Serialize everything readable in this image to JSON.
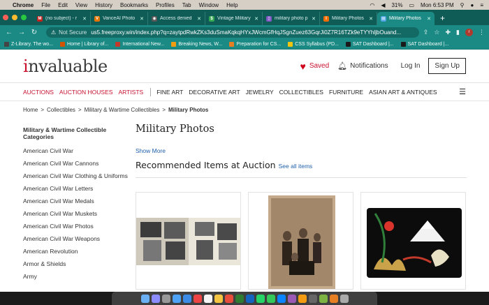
{
  "menubar": {
    "app": "Chrome",
    "items": [
      "File",
      "Edit",
      "View",
      "History",
      "Bookmarks",
      "Profiles",
      "Tab",
      "Window",
      "Help"
    ],
    "battery": "31%",
    "clock": "Mon 6:53 PM"
  },
  "tabs": [
    {
      "title": "(no subject) - r",
      "fav_color": "#c5221f",
      "fav_glyph": "M"
    },
    {
      "title": "VanceAI Photo",
      "fav_color": "#e37400",
      "fav_glyph": "V"
    },
    {
      "title": "Access denied",
      "fav_color": "#555555",
      "fav_glyph": "◉"
    },
    {
      "title": "Vintage Military",
      "fav_color": "#34a853",
      "fav_glyph": "$"
    },
    {
      "title": "military photo p",
      "fav_color": "#7e57c2",
      "fav_glyph": "▯"
    },
    {
      "title": "Military Photos",
      "fav_color": "#ef6c00",
      "fav_glyph": "I"
    },
    {
      "title": "Military Photos",
      "fav_color": "#4aa3df",
      "fav_glyph": "▤",
      "active": true
    }
  ],
  "toolbar": {
    "not_secure": "Not Secure",
    "url": "us5.freeproxy.win/index.php?q=zaytpdRwkZKs3duSmaKqkqHYxJWcmGfHqJSgnZuez63GqrJi0Z7R16TZk9eTYYhljbOuand..."
  },
  "bookmarks": [
    {
      "label": "Z-Library. The wo...",
      "color": "#444444"
    },
    {
      "label": "Home | Library of...",
      "color": "#d35400"
    },
    {
      "label": "International New...",
      "color": "#c0392b"
    },
    {
      "label": "Breaking News, W...",
      "color": "#f39c12"
    },
    {
      "label": "Preparation for CS...",
      "color": "#e67e22"
    },
    {
      "label": "CSS Syllabus (PD...",
      "color": "#f1c40f"
    },
    {
      "label": "SAT Dashboard |...",
      "color": "#1a1a1a"
    },
    {
      "label": "SAT Dashboard |...",
      "color": "#1a1a1a"
    }
  ],
  "site": {
    "logo_i": "i",
    "logo_rest": "nvaluable",
    "saved": "Saved",
    "notifications": "Notifications",
    "login": "Log In",
    "signup": "Sign Up",
    "nav_red": [
      "AUCTIONS",
      "AUCTION HOUSES",
      "ARTISTS"
    ],
    "nav": [
      "FINE ART",
      "DECORATIVE ART",
      "JEWELRY",
      "COLLECTIBLES",
      "FURNITURE",
      "ASIAN ART & ANTIQUES"
    ],
    "breadcrumb": [
      "Home",
      "Collectibles",
      "Military & Wartime Collectibles"
    ],
    "breadcrumb_current": "Military Photos",
    "sidebar_heading": "Military & Wartime Collectible Categories",
    "sidebar_items": [
      "American Civil War",
      "American Civil War Cannons",
      "American Civil War Clothing & Uniforms",
      "American Civil War Letters",
      "American Civil War Medals",
      "American Civil War Muskets",
      "American Civil War Photos",
      "American Civil War Weapons",
      "American Revolution",
      "Armor & Shields",
      "Army"
    ],
    "page_title": "Military Photos",
    "show_more": "Show More",
    "recommended": "Recommended Items at Auction",
    "see_all": "See all items"
  }
}
